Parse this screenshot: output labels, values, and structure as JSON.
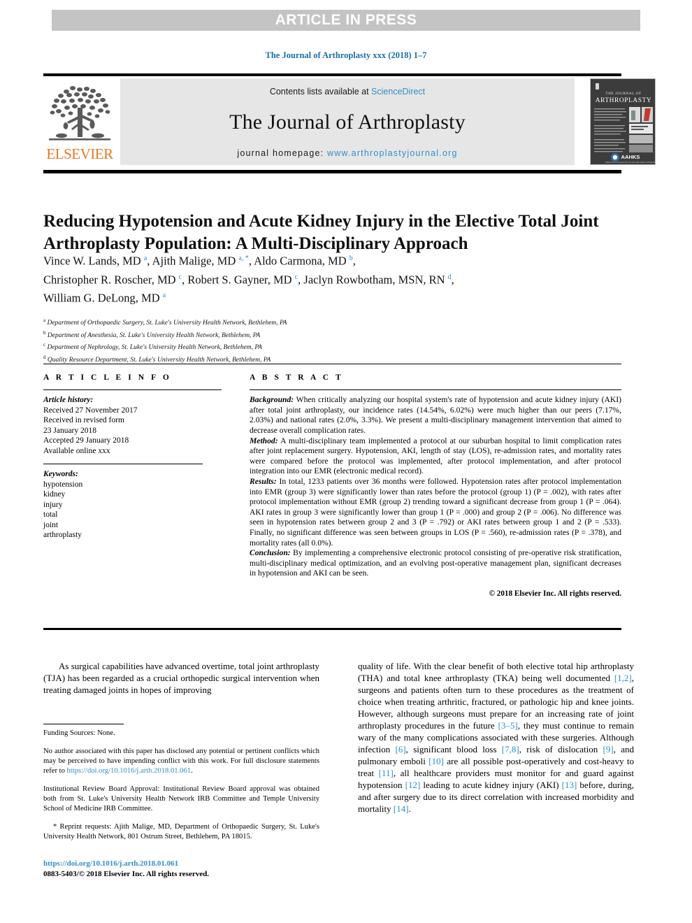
{
  "banner": {
    "label": "ARTICLE IN PRESS"
  },
  "running_head": {
    "text": "The Journal of Arthroplasty xxx (2018) 1–7"
  },
  "masthead": {
    "publisher_name": "ELSEVIER",
    "contents_prefix": "Contents lists available at ",
    "contents_link": "ScienceDirect",
    "journal_name": "The Journal of Arthroplasty",
    "homepage_prefix": "journal homepage: ",
    "homepage_url": "www.arthroplastyjournal.org",
    "cover": {
      "line1": "THE JOURNAL OF",
      "line2": "ARTHROPLASTY",
      "society": "AAHKS",
      "society_sub": "AMERICAN ASSOCIATION OF HIP AND KNEE SURGEONS"
    }
  },
  "article": {
    "title": "Reducing Hypotension and Acute Kidney Injury in the Elective Total Joint Arthroplasty Population: A Multi-Disciplinary Approach",
    "authors_html": "Vince W. Lands, MD <sup>a</sup>, Ajith Malige, MD <sup>a, *</sup>, Aldo Carmona, MD <sup>b</sup>,<br>Christopher R. Roscher, MD <sup>c</sup>, Robert S. Gayner, MD <sup>c</sup>, Jaclyn Rowbotham, MSN, RN <sup>d</sup>,<br>William G. DeLong, MD <sup>a</sup>",
    "affiliations": [
      {
        "mark": "a",
        "text": "Department of Orthopaedic Surgery, St. Luke's University Health Network, Bethlehem, PA"
      },
      {
        "mark": "b",
        "text": "Department of Anesthesia, St. Luke's University Health Network, Bethlehem, PA"
      },
      {
        "mark": "c",
        "text": "Department of Nephrology, St. Luke's University Health Network, Bethlehem, PA"
      },
      {
        "mark": "d",
        "text": "Quality Resource Department, St. Luke's University Health Network, Bethlehem, PA"
      }
    ]
  },
  "article_info": {
    "heading": "A R T I C L E   I N F O",
    "history_label": "Article history:",
    "history": [
      "Received 27 November 2017",
      "Received in revised form",
      "23 January 2018",
      "Accepted 29 January 2018",
      "Available online xxx"
    ],
    "keywords_label": "Keywords:",
    "keywords": [
      "hypotension",
      "kidney",
      "injury",
      "total",
      "joint",
      "arthroplasty"
    ]
  },
  "abstract": {
    "heading": "A B S T R A C T",
    "sections": [
      {
        "label": "Background:",
        "text": " When critically analyzing our hospital system's rate of hypotension and acute kidney injury (AKI) after total joint arthroplasty, our incidence rates (14.54%, 6.02%) were much higher than our peers (7.17%, 2.03%) and national rates (2.0%, 3.3%). We present a multi-disciplinary management intervention that aimed to decrease overall complication rates."
      },
      {
        "label": "Method:",
        "text": " A multi-disciplinary team implemented a protocol at our suburban hospital to limit complication rates after joint replacement surgery. Hypotension, AKI, length of stay (LOS), re-admission rates, and mortality rates were compared before the protocol was implemented, after protocol implementation, and after protocol integration into our EMR (electronic medical record)."
      },
      {
        "label": "Results:",
        "text": " In total, 1233 patients over 36 months were followed. Hypotension rates after protocol implementation into EMR (group 3) were significantly lower than rates before the protocol (group 1) (P = .002), with rates after protocol implementation without EMR (group 2) trending toward a significant decrease from group 1 (P = .064). AKI rates in group 3 were significantly lower than group 1 (P = .000) and group 2 (P = .006). No difference was seen in hypotension rates between group 2 and 3 (P = .792) or AKI rates between group 1 and 2 (P = .533). Finally, no significant difference was seen between groups in LOS (P = .560), re-admission rates (P = .378), and mortality rates (all 0.0%)."
      },
      {
        "label": "Conclusion:",
        "text": " By implementing a comprehensive electronic protocol consisting of pre-operative risk stratification, multi-disciplinary medical optimization, and an evolving post-operative management plan, significant decreases in hypotension and AKI can be seen."
      }
    ],
    "copyright": "© 2018 Elsevier Inc. All rights reserved."
  },
  "body": {
    "left_paragraph": "As surgical capabilities have advanced overtime, total joint arthroplasty (TJA) has been regarded as a crucial orthopedic surgical intervention when treating damaged joints in hopes of improving",
    "right_paragraph_html": "quality of life. With the clear benefit of both elective total hip arthroplasty (THA) and total knee arthroplasty (TKA) being well documented <span class=\"ref\">[1,2]</span>, surgeons and patients often turn to these procedures as the treatment of choice when treating arthritic, fractured, or pathologic hip and knee joints. However, although surgeons must prepare for an increasing rate of joint arthroplasty procedures in the future <span class=\"ref\">[3–5]</span>, they must continue to remain wary of the many complications associated with these surgeries. Although infection <span class=\"ref\">[6]</span>, significant blood loss <span class=\"ref\">[7,8]</span>, risk of dislocation <span class=\"ref\">[9]</span>, and pulmonary emboli <span class=\"ref\">[10]</span> are all possible post-operatively and cost-heavy to treat <span class=\"ref\">[11]</span>, all healthcare providers must monitor for and guard against hypotension <span class=\"ref\">[12]</span> leading to acute kidney injury (AKI) <span class=\"ref\">[13]</span> before, during, and after surgery due to its direct correlation with increased morbidity and mortality <span class=\"ref\">[14]</span>."
  },
  "footnotes": {
    "funding": "Funding Sources: None.",
    "disclosure_html": "No author associated with this paper has disclosed any potential or pertinent conflicts which may be perceived to have impending conflict with this work. For full disclosure statements refer to <span class=\"link\">https://doi.org/10.1016/j.arth.2018.01.061</span>.",
    "irb": "Institutional Review Board Approval: Institutional Review Board approval was obtained both from St. Luke's University Health Network IRB Committee and Temple University School of Medicine IRB Committee.",
    "reprint_html": "<span style=\"padding-left:14px\">*</span> Reprint requests: Ajith Malige, MD, Department of Orthopaedic Surgery, St. Luke's University Health Network, 801 Ostrum Street, Bethlehem, PA 18015."
  },
  "doi_footer": {
    "doi": "https://doi.org/10.1016/j.arth.2018.01.061",
    "issn_line": "0883-5403/© 2018 Elsevier Inc. All rights reserved."
  },
  "colors": {
    "link": "#2f8fcb",
    "banner_bg": "#c4c4c4",
    "masthead_bg": "#e6e6e6",
    "elsevier_orange": "#e87722",
    "running_head": "#1a6fa8"
  }
}
